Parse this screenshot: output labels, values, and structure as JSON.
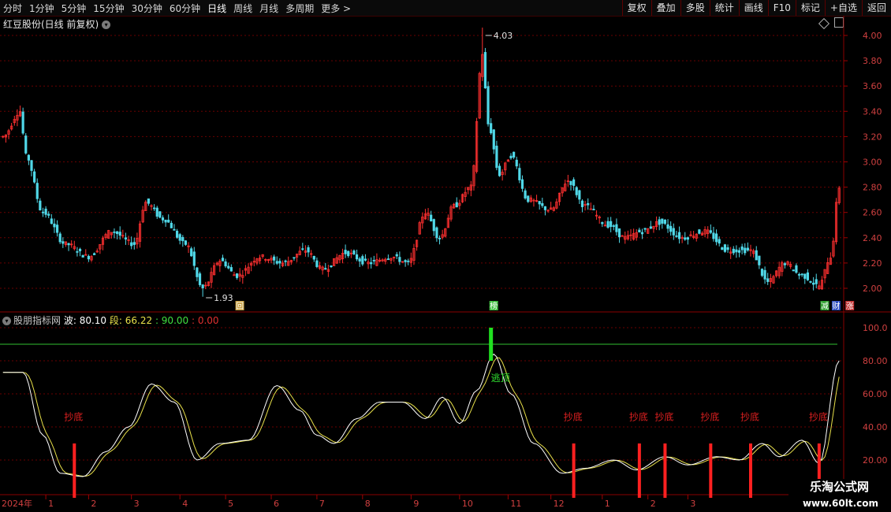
{
  "toolbar": {
    "periods": [
      "分时",
      "1分钟",
      "5分钟",
      "15分钟",
      "30分钟",
      "60分钟",
      "日线",
      "周线",
      "月线",
      "多周期",
      "更多 >"
    ],
    "active_index": 6,
    "right_buttons": [
      "复权",
      "叠加",
      "多股",
      "统计",
      "画线",
      "F10",
      "标记",
      "+自选",
      "返回"
    ]
  },
  "main_chart": {
    "title": "红豆股份(日线 前复权)",
    "title_icon": "chevron-down-icon",
    "high_label": "4.03",
    "low_label": "1.93",
    "y_ticks": [
      "4.00",
      "3.80",
      "3.60",
      "3.40",
      "3.20",
      "3.00",
      "2.80",
      "2.60",
      "2.40",
      "2.20",
      "2.00"
    ],
    "markers": [
      {
        "text": "回",
        "bg": "#c8a040"
      },
      {
        "text": "榜",
        "bg": "#40c040"
      },
      {
        "text": "减",
        "bg": "#30a030"
      },
      {
        "text": "财",
        "bg": "#3050c0"
      },
      {
        "text": "涨",
        "bg": "#c03030"
      }
    ],
    "up_color": "#ff3030",
    "down_color": "#50d8e8"
  },
  "indicator": {
    "name": "股朋指标网",
    "wave_label": "波: 80.10",
    "seg_label": "段: 66.22",
    "level_label": ": 90.00",
    "zero_label": ": 0.00",
    "y_ticks": [
      "100.0",
      "80.00",
      "60.00",
      "40.00",
      "20.00"
    ],
    "signal_bottom": "抄底",
    "signal_top": "逃顶"
  },
  "x_axis": {
    "labels": [
      "2024年",
      "1",
      "2",
      "3",
      "4",
      "5",
      "6",
      "7",
      "8",
      "9",
      "10",
      "11",
      "12",
      "1",
      "2",
      "3"
    ]
  },
  "watermark": {
    "line1": "乐淘公式网",
    "line2": "www.60lt.com"
  },
  "chart_data": {
    "type": "candlestick",
    "title": "红豆股份(日线 前复权)",
    "price_ylim": [
      1.93,
      4.03
    ],
    "price_anchors": [
      {
        "i": 0,
        "p": 3.2
      },
      {
        "i": 6,
        "p": 3.4
      },
      {
        "i": 8,
        "p": 3.05
      },
      {
        "i": 14,
        "p": 2.6
      },
      {
        "i": 22,
        "p": 2.35
      },
      {
        "i": 30,
        "p": 2.25
      },
      {
        "i": 38,
        "p": 2.45
      },
      {
        "i": 46,
        "p": 2.35
      },
      {
        "i": 50,
        "p": 2.68
      },
      {
        "i": 56,
        "p": 2.55
      },
      {
        "i": 64,
        "p": 2.35
      },
      {
        "i": 70,
        "p": 2.0
      },
      {
        "i": 76,
        "p": 2.22
      },
      {
        "i": 82,
        "p": 2.1
      },
      {
        "i": 90,
        "p": 2.25
      },
      {
        "i": 98,
        "p": 2.2
      },
      {
        "i": 106,
        "p": 2.3
      },
      {
        "i": 112,
        "p": 2.15
      },
      {
        "i": 120,
        "p": 2.28
      },
      {
        "i": 128,
        "p": 2.2
      },
      {
        "i": 136,
        "p": 2.25
      },
      {
        "i": 142,
        "p": 2.2
      },
      {
        "i": 148,
        "p": 2.6
      },
      {
        "i": 153,
        "p": 2.4
      },
      {
        "i": 158,
        "p": 2.65
      },
      {
        "i": 164,
        "p": 2.8
      },
      {
        "i": 168,
        "p": 3.85
      },
      {
        "i": 170,
        "p": 3.3
      },
      {
        "i": 174,
        "p": 2.9
      },
      {
        "i": 178,
        "p": 3.05
      },
      {
        "i": 184,
        "p": 2.7
      },
      {
        "i": 192,
        "p": 2.62
      },
      {
        "i": 198,
        "p": 2.85
      },
      {
        "i": 204,
        "p": 2.65
      },
      {
        "i": 212,
        "p": 2.5
      },
      {
        "i": 218,
        "p": 2.4
      },
      {
        "i": 224,
        "p": 2.45
      },
      {
        "i": 230,
        "p": 2.52
      },
      {
        "i": 238,
        "p": 2.4
      },
      {
        "i": 246,
        "p": 2.45
      },
      {
        "i": 254,
        "p": 2.3
      },
      {
        "i": 262,
        "p": 2.3
      },
      {
        "i": 268,
        "p": 2.05
      },
      {
        "i": 274,
        "p": 2.2
      },
      {
        "i": 280,
        "p": 2.1
      },
      {
        "i": 286,
        "p": 2.02
      },
      {
        "i": 290,
        "p": 2.25
      },
      {
        "i": 293,
        "p": 2.8
      }
    ],
    "indicator_ylim": [
      0,
      100
    ],
    "indicator_level": 90,
    "indicator_wave_anchors": [
      {
        "i": 0,
        "v": 73
      },
      {
        "i": 7,
        "v": 73
      },
      {
        "i": 14,
        "v": 35
      },
      {
        "i": 20,
        "v": 12
      },
      {
        "i": 28,
        "v": 10
      },
      {
        "i": 36,
        "v": 25
      },
      {
        "i": 44,
        "v": 40
      },
      {
        "i": 52,
        "v": 66
      },
      {
        "i": 60,
        "v": 55
      },
      {
        "i": 68,
        "v": 20
      },
      {
        "i": 76,
        "v": 30
      },
      {
        "i": 86,
        "v": 32
      },
      {
        "i": 96,
        "v": 65
      },
      {
        "i": 104,
        "v": 50
      },
      {
        "i": 110,
        "v": 35
      },
      {
        "i": 116,
        "v": 30
      },
      {
        "i": 124,
        "v": 45
      },
      {
        "i": 132,
        "v": 55
      },
      {
        "i": 140,
        "v": 55
      },
      {
        "i": 148,
        "v": 45
      },
      {
        "i": 154,
        "v": 58
      },
      {
        "i": 160,
        "v": 42
      },
      {
        "i": 166,
        "v": 62
      },
      {
        "i": 172,
        "v": 84
      },
      {
        "i": 178,
        "v": 60
      },
      {
        "i": 186,
        "v": 30
      },
      {
        "i": 196,
        "v": 12
      },
      {
        "i": 204,
        "v": 15
      },
      {
        "i": 214,
        "v": 20
      },
      {
        "i": 222,
        "v": 14
      },
      {
        "i": 232,
        "v": 22
      },
      {
        "i": 240,
        "v": 17
      },
      {
        "i": 250,
        "v": 22
      },
      {
        "i": 258,
        "v": 20
      },
      {
        "i": 266,
        "v": 30
      },
      {
        "i": 272,
        "v": 22
      },
      {
        "i": 280,
        "v": 32
      },
      {
        "i": 286,
        "v": 18
      },
      {
        "i": 293,
        "v": 80
      }
    ],
    "signals_bottom_idx": [
      25,
      200,
      223,
      232,
      248,
      262,
      286
    ],
    "signal_top_idx": 171,
    "bar_count": 294
  }
}
